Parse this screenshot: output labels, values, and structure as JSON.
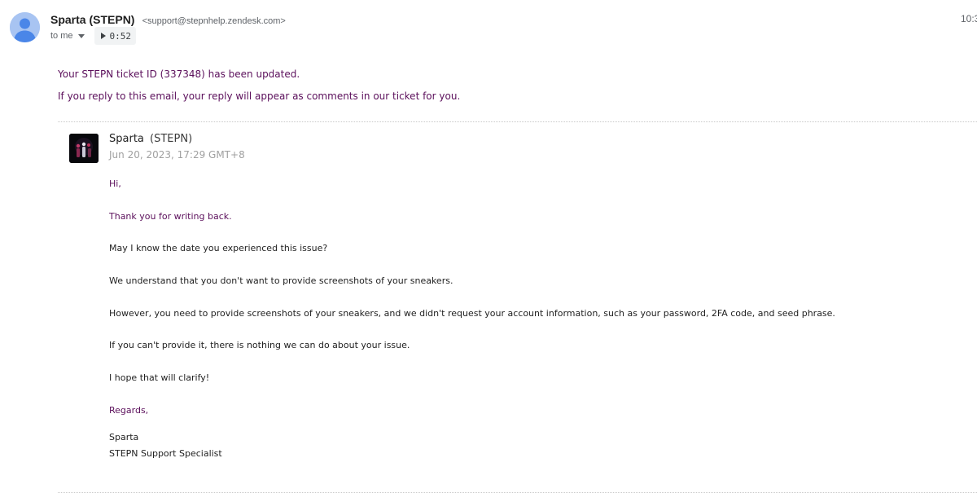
{
  "header": {
    "sender_name": "Sparta (STEPN)",
    "sender_email": "<support@stepnhelp.zendesk.com>",
    "recipient_label": "to me",
    "audio_duration": "0:52",
    "timestamp": "10:3"
  },
  "notice": {
    "line1": "Your STEPN ticket ID (337348) has been updated.",
    "line2": "If you reply to this email, your reply will appear as comments in our ticket for you."
  },
  "comment": {
    "author_first": "Sparta",
    "author_org": "(STEPN)",
    "date": "Jun 20, 2023, 17:29 GMT+8",
    "messages": [
      "Hi,",
      "Thank you for writing back.",
      "May I know the date you experienced this issue?",
      "We understand that you don't want to provide screenshots of your sneakers.",
      "However, you need to provide screenshots of your sneakers, and we didn't request your account information, such as your password, 2FA code, and seed phrase.",
      "If you can't provide it, there is nothing we can do about your issue.",
      "I hope that will clarify!",
      "Regards,"
    ],
    "signature": {
      "name": "Sparta",
      "title": "STEPN Support Specialist"
    }
  },
  "icons": {
    "sender_avatar": "person-avatar-icon",
    "caret": "chevron-down-icon",
    "play": "play-icon"
  },
  "colors": {
    "notice_text": "#5b0f5b",
    "avatar_bg": "#a8c4f2",
    "avatar_figure": "#4a86e8"
  }
}
